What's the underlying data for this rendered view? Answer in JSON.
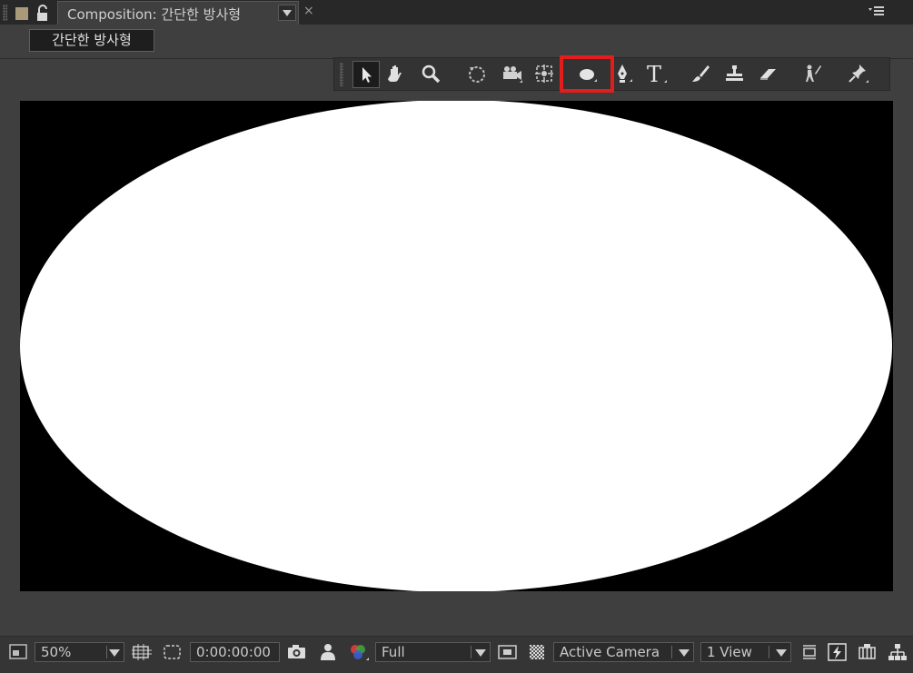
{
  "tab": {
    "title": "Composition: 간단한 방사형",
    "close_glyph": "×",
    "menu_icon": "panel-menu-icon"
  },
  "breadcrumb": {
    "label": "간단한 방사형"
  },
  "tools": {
    "items": [
      {
        "name": "selection-tool",
        "icon": "arrow-cursor-icon",
        "selected": true
      },
      {
        "name": "hand-tool",
        "icon": "hand-icon"
      },
      {
        "name": "zoom-tool",
        "icon": "magnifier-icon"
      },
      {
        "name": "rotation-tool",
        "icon": "rotate-icon"
      },
      {
        "name": "unified-camera-tool",
        "icon": "camera-icon"
      },
      {
        "name": "pan-behind-tool",
        "icon": "pan-behind-icon"
      },
      {
        "name": "ellipse-tool",
        "icon": "ellipse-icon",
        "highlighted": true
      },
      {
        "name": "pen-tool",
        "icon": "pen-icon"
      },
      {
        "name": "type-tool",
        "icon": "type-icon",
        "glyph": "T"
      },
      {
        "name": "brush-tool",
        "icon": "brush-icon"
      },
      {
        "name": "clone-stamp-tool",
        "icon": "stamp-icon"
      },
      {
        "name": "eraser-tool",
        "icon": "eraser-icon"
      },
      {
        "name": "roto-brush-tool",
        "icon": "roto-brush-icon"
      },
      {
        "name": "puppet-pin-tool",
        "icon": "pin-icon"
      }
    ],
    "highlight_color": "#e31c1c"
  },
  "viewer": {
    "background": "#000000",
    "shape_fill": "#ffffff",
    "shape": "ellipse"
  },
  "footer": {
    "magnification": "50%",
    "timecode": "0:00:00:00",
    "resolution": "Full",
    "camera": "Active Camera",
    "view_layout": "1 View"
  }
}
